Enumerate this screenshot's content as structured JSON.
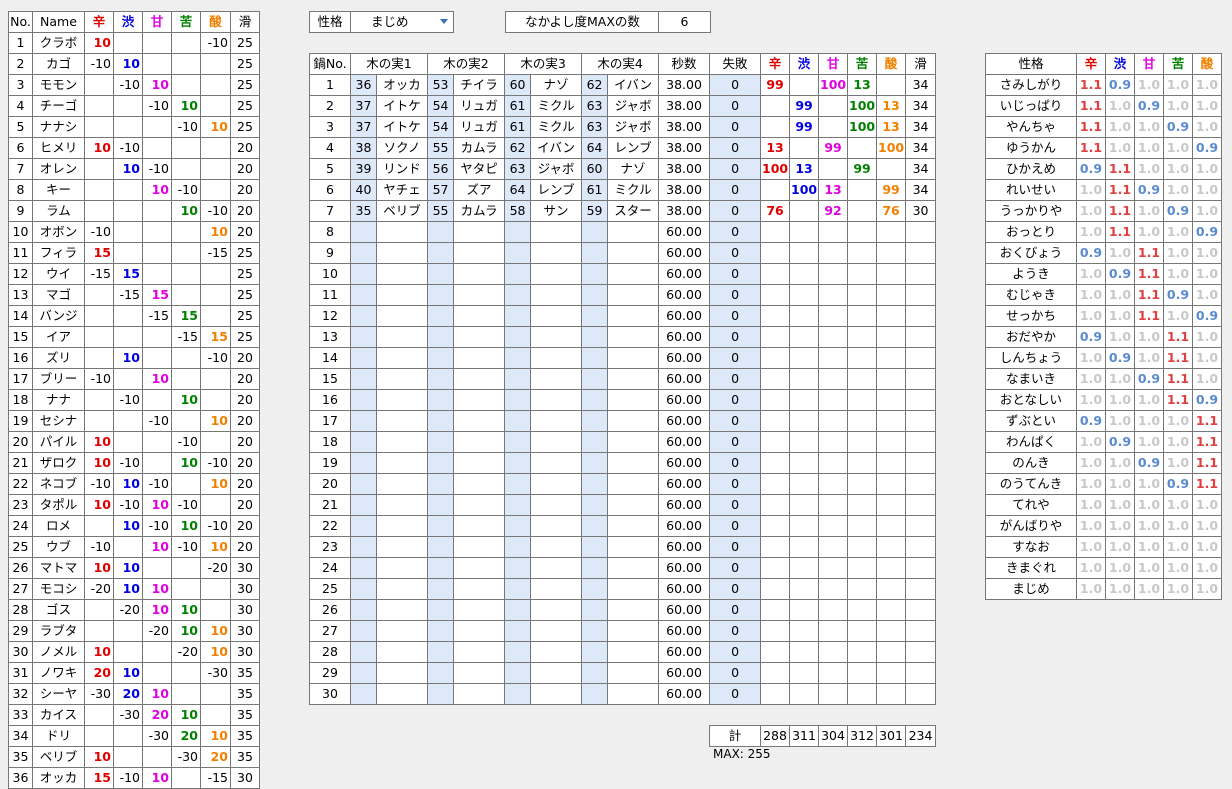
{
  "flavors": [
    "辛",
    "渋",
    "甘",
    "苦",
    "酸"
  ],
  "berry_table": {
    "headers": {
      "no": "No.",
      "name": "Name",
      "smooth": "滑"
    },
    "rows": [
      {
        "no": "1",
        "name": "クラボ",
        "v": [
          "10",
          "",
          "",
          "",
          "-10"
        ],
        "s": "25"
      },
      {
        "no": "2",
        "name": "カゴ",
        "v": [
          "-10",
          "10",
          "",
          "",
          ""
        ],
        "s": "25"
      },
      {
        "no": "3",
        "name": "モモン",
        "v": [
          "",
          "-10",
          "10",
          "",
          ""
        ],
        "s": "25"
      },
      {
        "no": "4",
        "name": "チーゴ",
        "v": [
          "",
          "",
          "-10",
          "10",
          ""
        ],
        "s": "25"
      },
      {
        "no": "5",
        "name": "ナナシ",
        "v": [
          "",
          "",
          "",
          "-10",
          "10"
        ],
        "s": "25"
      },
      {
        "no": "6",
        "name": "ヒメリ",
        "v": [
          "10",
          "-10",
          "",
          "",
          ""
        ],
        "s": "20"
      },
      {
        "no": "7",
        "name": "オレン",
        "v": [
          "",
          "10",
          "-10",
          "",
          ""
        ],
        "s": "20"
      },
      {
        "no": "8",
        "name": "キー",
        "v": [
          "",
          "",
          "10",
          "-10",
          ""
        ],
        "s": "20"
      },
      {
        "no": "9",
        "name": "ラム",
        "v": [
          "",
          "",
          "",
          "10",
          "-10"
        ],
        "s": "20"
      },
      {
        "no": "10",
        "name": "オボン",
        "v": [
          "-10",
          "",
          "",
          "",
          "10"
        ],
        "s": "20"
      },
      {
        "no": "11",
        "name": "フィラ",
        "v": [
          "15",
          "",
          "",
          "",
          "-15"
        ],
        "s": "25"
      },
      {
        "no": "12",
        "name": "ウイ",
        "v": [
          "-15",
          "15",
          "",
          "",
          ""
        ],
        "s": "25"
      },
      {
        "no": "13",
        "name": "マゴ",
        "v": [
          "",
          "-15",
          "15",
          "",
          ""
        ],
        "s": "25"
      },
      {
        "no": "14",
        "name": "バンジ",
        "v": [
          "",
          "",
          "-15",
          "15",
          ""
        ],
        "s": "25"
      },
      {
        "no": "15",
        "name": "イア",
        "v": [
          "",
          "",
          "",
          "-15",
          "15"
        ],
        "s": "25"
      },
      {
        "no": "16",
        "name": "ズリ",
        "v": [
          "",
          "10",
          "",
          "",
          "-10"
        ],
        "s": "20"
      },
      {
        "no": "17",
        "name": "ブリー",
        "v": [
          "-10",
          "",
          "10",
          "",
          ""
        ],
        "s": "20"
      },
      {
        "no": "18",
        "name": "ナナ",
        "v": [
          "",
          "-10",
          "",
          "10",
          ""
        ],
        "s": "20"
      },
      {
        "no": "19",
        "name": "セシナ",
        "v": [
          "",
          "",
          "-10",
          "",
          "10"
        ],
        "s": "20"
      },
      {
        "no": "20",
        "name": "パイル",
        "v": [
          "10",
          "",
          "",
          "-10",
          ""
        ],
        "s": "20"
      },
      {
        "no": "21",
        "name": "ザロク",
        "v": [
          "10",
          "-10",
          "",
          "10",
          "-10"
        ],
        "s": "20"
      },
      {
        "no": "22",
        "name": "ネコブ",
        "v": [
          "-10",
          "10",
          "-10",
          "",
          "10"
        ],
        "s": "20"
      },
      {
        "no": "23",
        "name": "タポル",
        "v": [
          "10",
          "-10",
          "10",
          "-10",
          ""
        ],
        "s": "20"
      },
      {
        "no": "24",
        "name": "ロメ",
        "v": [
          "",
          "10",
          "-10",
          "10",
          "-10"
        ],
        "s": "20"
      },
      {
        "no": "25",
        "name": "ウブ",
        "v": [
          "-10",
          "",
          "10",
          "-10",
          "10"
        ],
        "s": "20"
      },
      {
        "no": "26",
        "name": "マトマ",
        "v": [
          "10",
          "10",
          "",
          "",
          "-20"
        ],
        "s": "30"
      },
      {
        "no": "27",
        "name": "モコシ",
        "v": [
          "-20",
          "10",
          "10",
          "",
          ""
        ],
        "s": "30"
      },
      {
        "no": "28",
        "name": "ゴス",
        "v": [
          "",
          "-20",
          "10",
          "10",
          ""
        ],
        "s": "30"
      },
      {
        "no": "29",
        "name": "ラブタ",
        "v": [
          "",
          "",
          "-20",
          "10",
          "10"
        ],
        "s": "30"
      },
      {
        "no": "30",
        "name": "ノメル",
        "v": [
          "10",
          "",
          "",
          "-20",
          "10"
        ],
        "s": "30"
      },
      {
        "no": "31",
        "name": "ノワキ",
        "v": [
          "20",
          "10",
          "",
          "",
          "-30"
        ],
        "s": "35"
      },
      {
        "no": "32",
        "name": "シーヤ",
        "v": [
          "-30",
          "20",
          "10",
          "",
          ""
        ],
        "s": "35"
      },
      {
        "no": "33",
        "name": "カイス",
        "v": [
          "",
          "-30",
          "20",
          "10",
          ""
        ],
        "s": "35"
      },
      {
        "no": "34",
        "name": "ドリ",
        "v": [
          "",
          "",
          "-30",
          "20",
          "10"
        ],
        "s": "35"
      },
      {
        "no": "35",
        "name": "ベリブ",
        "v": [
          "10",
          "",
          "",
          "-30",
          "20"
        ],
        "s": "35"
      },
      {
        "no": "36",
        "name": "オッカ",
        "v": [
          "15",
          "-10",
          "10",
          "",
          "-15"
        ],
        "s": "30"
      }
    ]
  },
  "controls": {
    "nature_label": "性格",
    "nature_value": "まじめ",
    "max_label": "なかよし度MAXの数",
    "max_value": "6"
  },
  "main_table": {
    "headers": {
      "pot": "鍋No.",
      "b1": "木の実1",
      "b2": "木の実2",
      "b3": "木の実3",
      "b4": "木の実4",
      "sec": "秒数",
      "fail": "失敗",
      "smooth": "滑"
    },
    "rows": [
      {
        "pot": "1",
        "b": [
          [
            "36",
            "オッカ"
          ],
          [
            "53",
            "チイラ"
          ],
          [
            "60",
            "ナゾ"
          ],
          [
            "62",
            "イバン"
          ]
        ],
        "sec": "38.00",
        "fail": "0",
        "f": [
          "99",
          "",
          "100",
          "13",
          ""
        ],
        "s": "34"
      },
      {
        "pot": "2",
        "b": [
          [
            "37",
            "イトケ"
          ],
          [
            "54",
            "リュガ"
          ],
          [
            "61",
            "ミクル"
          ],
          [
            "63",
            "ジャボ"
          ]
        ],
        "sec": "38.00",
        "fail": "0",
        "f": [
          "",
          "99",
          "",
          "100",
          "13"
        ],
        "s": "34"
      },
      {
        "pot": "3",
        "b": [
          [
            "37",
            "イトケ"
          ],
          [
            "54",
            "リュガ"
          ],
          [
            "61",
            "ミクル"
          ],
          [
            "63",
            "ジャボ"
          ]
        ],
        "sec": "38.00",
        "fail": "0",
        "f": [
          "",
          "99",
          "",
          "100",
          "13"
        ],
        "s": "34"
      },
      {
        "pot": "4",
        "b": [
          [
            "38",
            "ソクノ"
          ],
          [
            "55",
            "カムラ"
          ],
          [
            "62",
            "イバン"
          ],
          [
            "64",
            "レンブ"
          ]
        ],
        "sec": "38.00",
        "fail": "0",
        "f": [
          "13",
          "",
          "99",
          "",
          "100"
        ],
        "s": "34"
      },
      {
        "pot": "5",
        "b": [
          [
            "39",
            "リンド"
          ],
          [
            "56",
            "ヤタピ"
          ],
          [
            "63",
            "ジャボ"
          ],
          [
            "60",
            "ナゾ"
          ]
        ],
        "sec": "38.00",
        "fail": "0",
        "f": [
          "100",
          "13",
          "",
          "99",
          ""
        ],
        "s": "34"
      },
      {
        "pot": "6",
        "b": [
          [
            "40",
            "ヤチェ"
          ],
          [
            "57",
            "ズア"
          ],
          [
            "64",
            "レンブ"
          ],
          [
            "61",
            "ミクル"
          ]
        ],
        "sec": "38.00",
        "fail": "0",
        "f": [
          "",
          "100",
          "13",
          "",
          "99"
        ],
        "s": "34"
      },
      {
        "pot": "7",
        "b": [
          [
            "35",
            "ベリブ"
          ],
          [
            "55",
            "カムラ"
          ],
          [
            "58",
            "サン"
          ],
          [
            "59",
            "スター"
          ]
        ],
        "sec": "38.00",
        "fail": "0",
        "f": [
          "76",
          "",
          "92",
          "",
          "76"
        ],
        "s": "30"
      },
      {
        "pot": "8",
        "sec": "60.00",
        "fail": "0"
      },
      {
        "pot": "9",
        "sec": "60.00",
        "fail": "0"
      },
      {
        "pot": "10",
        "sec": "60.00",
        "fail": "0"
      },
      {
        "pot": "11",
        "sec": "60.00",
        "fail": "0"
      },
      {
        "pot": "12",
        "sec": "60.00",
        "fail": "0"
      },
      {
        "pot": "13",
        "sec": "60.00",
        "fail": "0"
      },
      {
        "pot": "14",
        "sec": "60.00",
        "fail": "0"
      },
      {
        "pot": "15",
        "sec": "60.00",
        "fail": "0"
      },
      {
        "pot": "16",
        "sec": "60.00",
        "fail": "0"
      },
      {
        "pot": "17",
        "sec": "60.00",
        "fail": "0"
      },
      {
        "pot": "18",
        "sec": "60.00",
        "fail": "0"
      },
      {
        "pot": "19",
        "sec": "60.00",
        "fail": "0"
      },
      {
        "pot": "20",
        "sec": "60.00",
        "fail": "0"
      },
      {
        "pot": "21",
        "sec": "60.00",
        "fail": "0"
      },
      {
        "pot": "22",
        "sec": "60.00",
        "fail": "0"
      },
      {
        "pot": "23",
        "sec": "60.00",
        "fail": "0"
      },
      {
        "pot": "24",
        "sec": "60.00",
        "fail": "0"
      },
      {
        "pot": "25",
        "sec": "60.00",
        "fail": "0"
      },
      {
        "pot": "26",
        "sec": "60.00",
        "fail": "0"
      },
      {
        "pot": "27",
        "sec": "60.00",
        "fail": "0"
      },
      {
        "pot": "28",
        "sec": "60.00",
        "fail": "0"
      },
      {
        "pot": "29",
        "sec": "60.00",
        "fail": "0"
      },
      {
        "pot": "30",
        "sec": "60.00",
        "fail": "0"
      }
    ]
  },
  "totals": {
    "label": "計",
    "values": [
      "288",
      "311",
      "304",
      "312",
      "301",
      "234"
    ],
    "max_text": "MAX: 255"
  },
  "nature_table": {
    "header": "性格",
    "rows": [
      {
        "name": "さみしがり",
        "m": [
          "1.1",
          "0.9",
          "1.0",
          "1.0",
          "1.0"
        ]
      },
      {
        "name": "いじっぱり",
        "m": [
          "1.1",
          "1.0",
          "0.9",
          "1.0",
          "1.0"
        ]
      },
      {
        "name": "やんちゃ",
        "m": [
          "1.1",
          "1.0",
          "1.0",
          "0.9",
          "1.0"
        ]
      },
      {
        "name": "ゆうかん",
        "m": [
          "1.1",
          "1.0",
          "1.0",
          "1.0",
          "0.9"
        ]
      },
      {
        "name": "ひかえめ",
        "m": [
          "0.9",
          "1.1",
          "1.0",
          "1.0",
          "1.0"
        ]
      },
      {
        "name": "れいせい",
        "m": [
          "1.0",
          "1.1",
          "0.9",
          "1.0",
          "1.0"
        ]
      },
      {
        "name": "うっかりや",
        "m": [
          "1.0",
          "1.1",
          "1.0",
          "0.9",
          "1.0"
        ]
      },
      {
        "name": "おっとり",
        "m": [
          "1.0",
          "1.1",
          "1.0",
          "1.0",
          "0.9"
        ]
      },
      {
        "name": "おくびょう",
        "m": [
          "0.9",
          "1.0",
          "1.1",
          "1.0",
          "1.0"
        ]
      },
      {
        "name": "ようき",
        "m": [
          "1.0",
          "0.9",
          "1.1",
          "1.0",
          "1.0"
        ]
      },
      {
        "name": "むじゃき",
        "m": [
          "1.0",
          "1.0",
          "1.1",
          "0.9",
          "1.0"
        ]
      },
      {
        "name": "せっかち",
        "m": [
          "1.0",
          "1.0",
          "1.1",
          "1.0",
          "0.9"
        ]
      },
      {
        "name": "おだやか",
        "m": [
          "0.9",
          "1.0",
          "1.0",
          "1.1",
          "1.0"
        ]
      },
      {
        "name": "しんちょう",
        "m": [
          "1.0",
          "0.9",
          "1.0",
          "1.1",
          "1.0"
        ]
      },
      {
        "name": "なまいき",
        "m": [
          "1.0",
          "1.0",
          "0.9",
          "1.1",
          "1.0"
        ]
      },
      {
        "name": "おとなしい",
        "m": [
          "1.0",
          "1.0",
          "1.0",
          "1.1",
          "0.9"
        ]
      },
      {
        "name": "ずぶとい",
        "m": [
          "0.9",
          "1.0",
          "1.0",
          "1.0",
          "1.1"
        ]
      },
      {
        "name": "わんぱく",
        "m": [
          "1.0",
          "0.9",
          "1.0",
          "1.0",
          "1.1"
        ]
      },
      {
        "name": "のんき",
        "m": [
          "1.0",
          "1.0",
          "0.9",
          "1.0",
          "1.1"
        ]
      },
      {
        "name": "のうてんき",
        "m": [
          "1.0",
          "1.0",
          "1.0",
          "0.9",
          "1.1"
        ]
      },
      {
        "name": "てれや",
        "m": [
          "1.0",
          "1.0",
          "1.0",
          "1.0",
          "1.0"
        ]
      },
      {
        "name": "がんばりや",
        "m": [
          "1.0",
          "1.0",
          "1.0",
          "1.0",
          "1.0"
        ]
      },
      {
        "name": "すなお",
        "m": [
          "1.0",
          "1.0",
          "1.0",
          "1.0",
          "1.0"
        ]
      },
      {
        "name": "きまぐれ",
        "m": [
          "1.0",
          "1.0",
          "1.0",
          "1.0",
          "1.0"
        ]
      },
      {
        "name": "まじめ",
        "m": [
          "1.0",
          "1.0",
          "1.0",
          "1.0",
          "1.0"
        ]
      }
    ]
  }
}
